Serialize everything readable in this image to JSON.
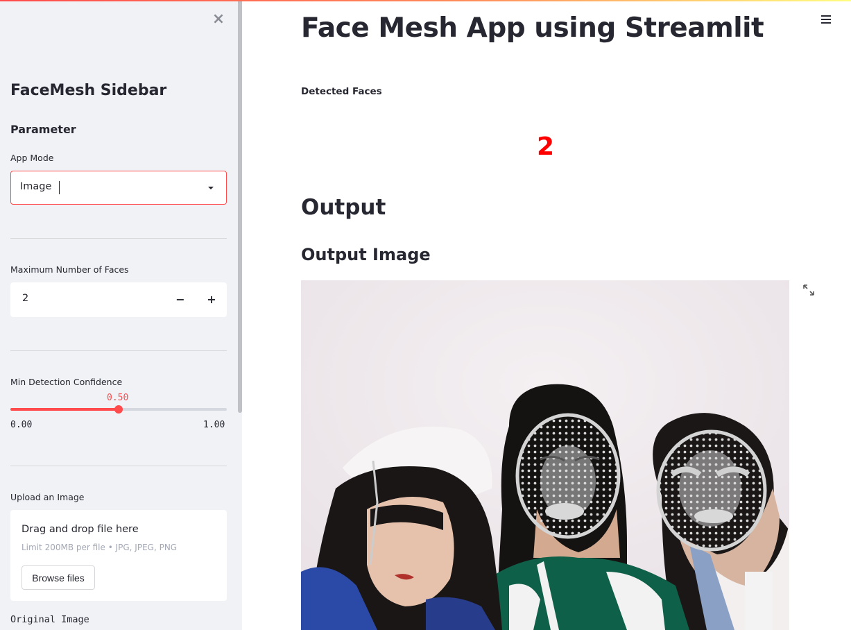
{
  "sidebar": {
    "close_label": "×",
    "title": "FaceMesh Sidebar",
    "subtitle": "Parameter",
    "app_mode": {
      "label": "App Mode",
      "value": "Image"
    },
    "max_faces": {
      "label": "Maximum Number of Faces",
      "value": "2",
      "decrement": "−",
      "increment": "+"
    },
    "confidence": {
      "label": "Min Detection Confidence",
      "value": 0.5,
      "value_text": "0.50",
      "min_text": "0.00",
      "max_text": "1.00"
    },
    "upload": {
      "label": "Upload an Image",
      "drop_text": "Drag and drop file here",
      "limit_text": "Limit 200MB per file • JPG, JPEG, PNG",
      "button_label": "Browse files"
    },
    "original_image_label": "Original Image"
  },
  "main": {
    "title": "Face Mesh App using Streamlit",
    "metric": {
      "label": "Detected Faces",
      "value": "2"
    },
    "output_heading": "Output",
    "output_image_heading": "Output Image"
  },
  "colors": {
    "accent": "#ff4b4b",
    "metric": "#ff0000",
    "sidebar_bg": "#f0f2f6",
    "text": "#262730"
  },
  "icons": {
    "menu": "hamburger-icon",
    "close": "close-icon",
    "expand": "fullscreen-icon",
    "dropdown": "caret-down-icon"
  }
}
